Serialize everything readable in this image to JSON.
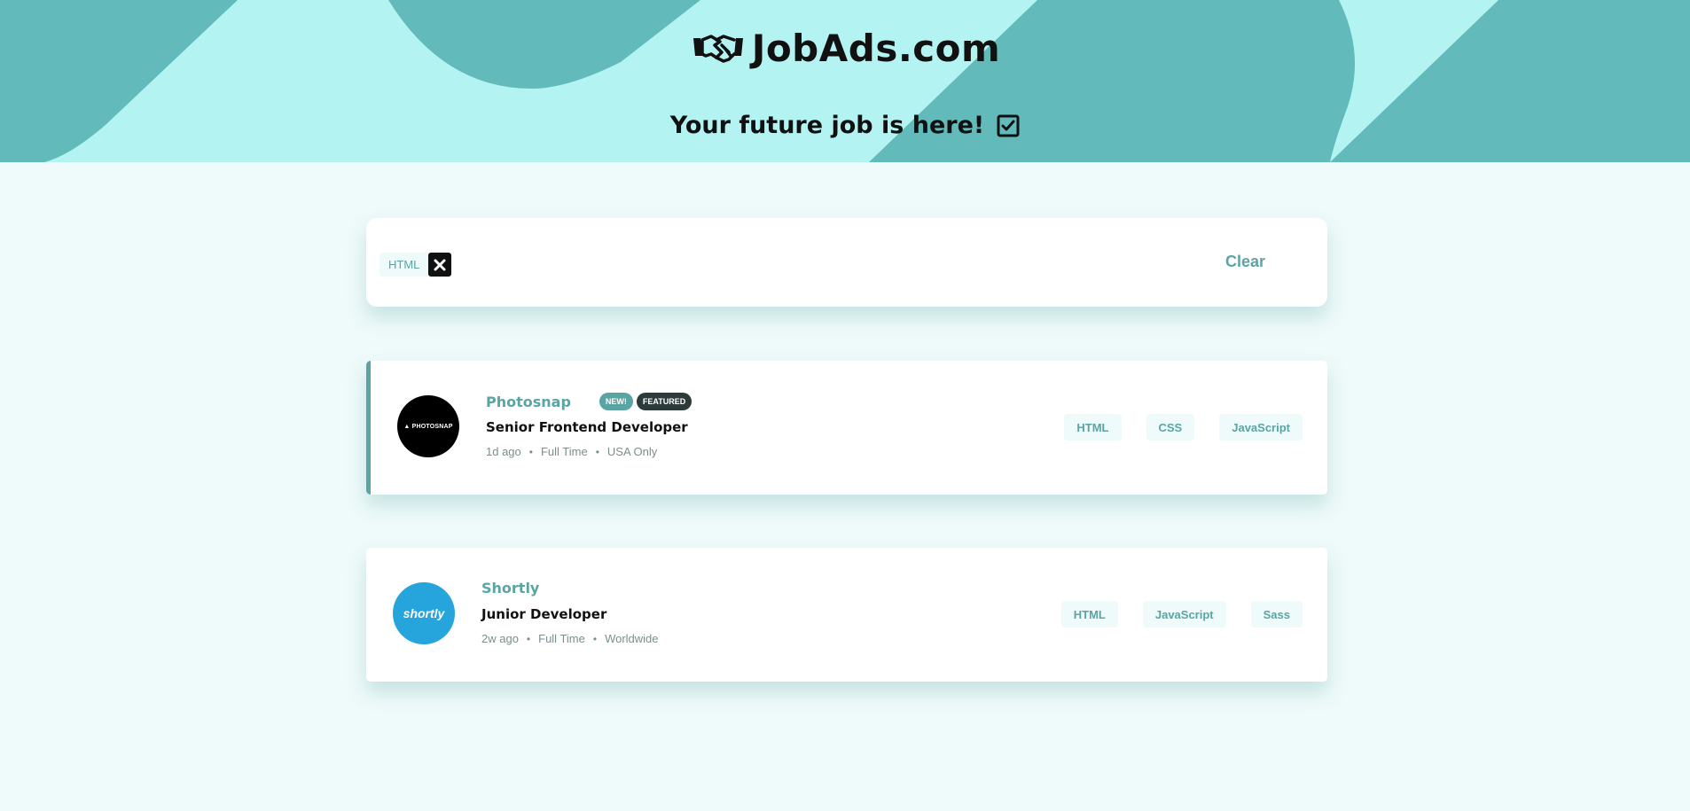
{
  "header": {
    "brand": "JobAds.com",
    "tagline": "Your future job is here!"
  },
  "colors": {
    "primary": "#5ba4a4",
    "background": "#effafa",
    "header_light": "#b3f4f3",
    "header_dark": "#63baba",
    "featured_badge": "#2c3a3a"
  },
  "filters": {
    "active": [
      "HTML"
    ],
    "clear_label": "Clear"
  },
  "jobs": [
    {
      "company": "Photosnap",
      "logo_text": "PHOTOSNAP",
      "new_label": "NEW!",
      "featured_label": "FEATURED",
      "position": "Senior Frontend Developer",
      "posted": "1d ago",
      "contract": "Full Time",
      "location": "USA Only",
      "tags": [
        "HTML",
        "CSS",
        "JavaScript"
      ]
    },
    {
      "company": "Shortly",
      "logo_text": "shortly",
      "position": "Junior Developer",
      "posted": "2w ago",
      "contract": "Full Time",
      "location": "Worldwide",
      "tags": [
        "HTML",
        "JavaScript",
        "Sass"
      ]
    }
  ]
}
